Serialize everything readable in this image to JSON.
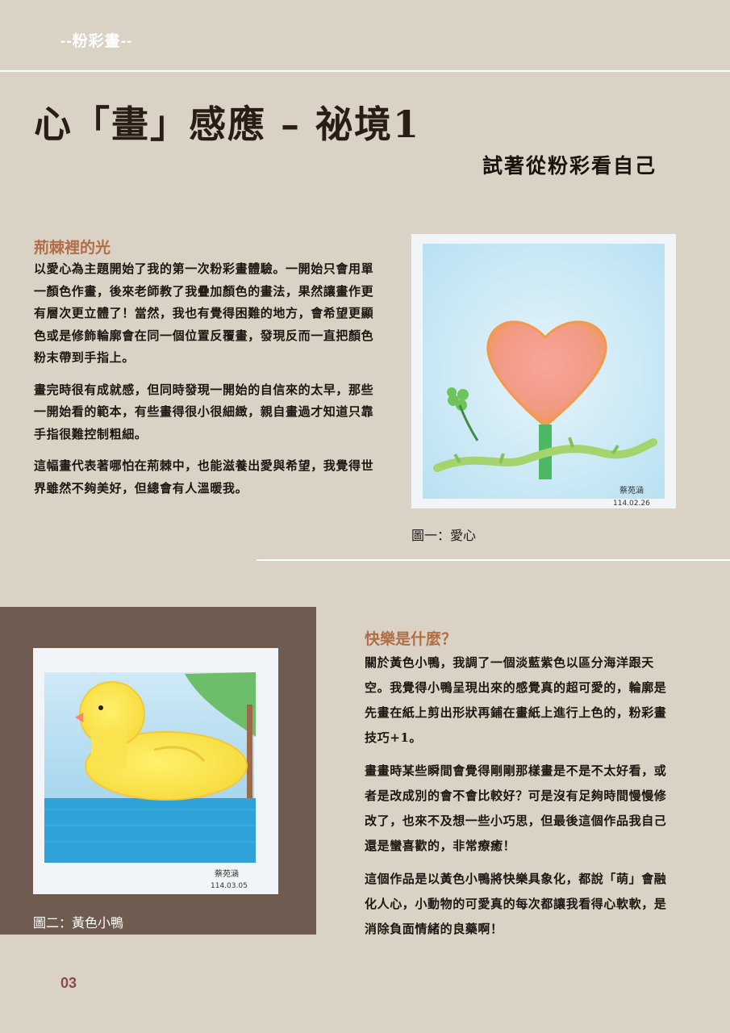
{
  "header": {
    "tag": "--粉彩畫--"
  },
  "title": "心「畫」感應 – 祕境1",
  "subtitle": "試著從粉彩看自己",
  "section1": {
    "heading": "荊棘裡的光",
    "paragraphs": [
      "以愛心為主題開始了我的第一次粉彩畫體驗。一開始只會用單一顏色作畫，後來老師教了我疊加顏色的畫法，果然讓畫作更有層次更立體了！當然，我也有覺得困難的地方，會希望更顯色或是修飾輪廓會在同一個位置反覆畫，發現反而一直把顏色粉末帶到手指上。",
      "畫完時很有成就感，但同時發現一開始的自信來的太早，那些一開始看的範本，有些畫得很小很細緻，親自畫過才知道只靠手指很難控制粗細。",
      "這幅畫代表著哪怕在荊棘中，也能滋養出愛與希望，我覺得世界雖然不夠美好，但總會有人溫暖我。"
    ],
    "caption": "圖一：愛心",
    "signature": "蔡苑涵",
    "date": "114.02.26"
  },
  "section2": {
    "heading": "快樂是什麼？",
    "paragraphs": [
      "關於黃色小鴨，我調了一個淡藍紫色以區分海洋跟天空。我覺得小鴨呈現出來的感覺真的超可愛的，輪廓是先畫在紙上剪出形狀再鋪在畫紙上進行上色的，粉彩畫技巧+1。",
      "畫畫時某些瞬間會覺得剛剛那樣畫是不是不太好看，或者是改成別的會不會比較好？可是沒有足夠時間慢慢修改了，也來不及想一些小巧思，但最後這個作品我自己還是蠻喜歡的，非常療癒！",
      "這個作品是以黃色小鴨將快樂具象化，都說「萌」會融化人心，小動物的可愛真的每次都讓我看得心軟軟，是消除負面情緒的良藥啊！"
    ],
    "caption": "圖二：黃色小鴨",
    "signature": "蔡苑涵",
    "date": "114.03.05"
  },
  "page_number": "03",
  "colors": {
    "background": "#dbd2c6",
    "accent_heading": "#b06e47",
    "dark_panel": "#6f5b4f",
    "page_number": "#8c4b4b"
  }
}
